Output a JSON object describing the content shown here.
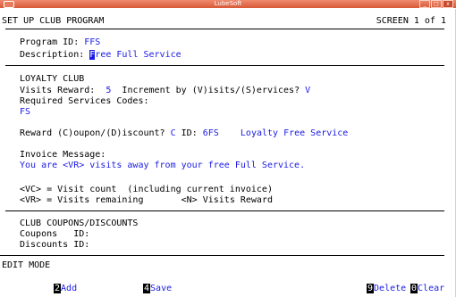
{
  "window": {
    "title": "LubeSoft",
    "controls": [
      "_",
      "□",
      "x"
    ]
  },
  "header": {
    "title": "SET UP CLUB PROGRAM",
    "screen": "SCREEN 1 of 1"
  },
  "program": {
    "id_label": "Program ID:",
    "id_value": "FFS",
    "desc_label": "Description:",
    "desc_first": "F",
    "desc_rest": "ree Full Service"
  },
  "loyalty": {
    "heading": "LOYALTY CLUB",
    "visits_label": "Visits Reward:",
    "visits_value": "5",
    "increment_label": "Increment by (V)isits/(S)ervices?",
    "increment_value": "V",
    "req_label": "Required Services Codes:",
    "req_value": "FS",
    "reward_label": "Reward (C)oupon/(D)iscount?",
    "reward_value": "C",
    "id_label": "ID:",
    "id_value": "6FS",
    "id_desc": "Loyalty Free Service",
    "invoice_label": "Invoice Message:",
    "invoice_message": "You are <VR> visits away from your free Full Service.",
    "legend_vc": "<VC> = Visit count  (including current invoice)",
    "legend_vr": "<VR> = Visits remaining",
    "legend_n": "<N> Visits Reward"
  },
  "club": {
    "heading": "CLUB COUPONS/DISCOUNTS",
    "coupons_label": "Coupons   ID:",
    "discounts_label": "Discounts ID:"
  },
  "mode": "EDIT MODE",
  "fkeys": [
    {
      "key": "2",
      "label": "Add"
    },
    {
      "key": "4",
      "label": "Save"
    },
    {
      "key": "9",
      "label": "Delete"
    },
    {
      "key": "0",
      "label": "Clear"
    }
  ]
}
